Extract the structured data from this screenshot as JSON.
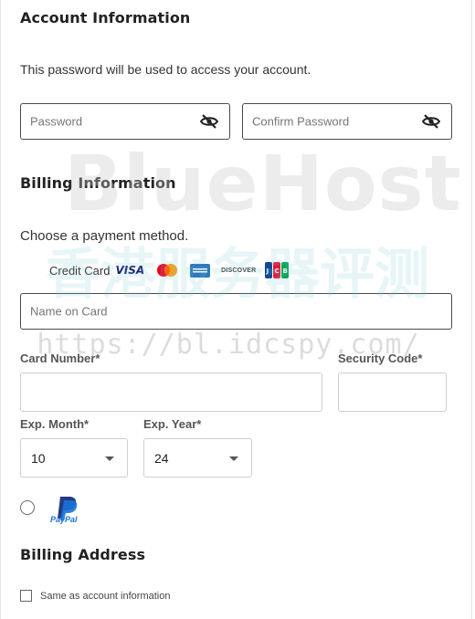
{
  "account": {
    "title": "Account Information",
    "helper": "This password will be used to access your account.",
    "password_placeholder": "Password",
    "confirm_placeholder": "Confirm Password"
  },
  "billing": {
    "title": "Billing Information",
    "choose_method": "Choose a payment method.",
    "credit_card_label": "Credit Card",
    "card_brands": [
      "VISA",
      "mastercard",
      "amex",
      "DISCOVER",
      "JCB"
    ],
    "name_on_card_placeholder": "Name on Card",
    "card_number_label": "Card Number*",
    "card_number_value": "",
    "security_code_label": "Security Code*",
    "security_code_value": "",
    "exp_month_label": "Exp. Month*",
    "exp_month_value": "10",
    "exp_year_label": "Exp. Year*",
    "exp_year_value": "24",
    "paypal_label": "PayPal"
  },
  "billing_address": {
    "title": "Billing Address",
    "same_as_account": "Same as account information"
  },
  "watermark": {
    "brand": "BlueHost",
    "chinese": "香港服务器评测",
    "url": "https://bl.idcspy.com/"
  },
  "colors": {
    "visa_blue": "#1a1f71",
    "paypal_blue": "#1a73d6",
    "paypal_dark": "#253b80",
    "field_border": "#4a4a4a"
  }
}
